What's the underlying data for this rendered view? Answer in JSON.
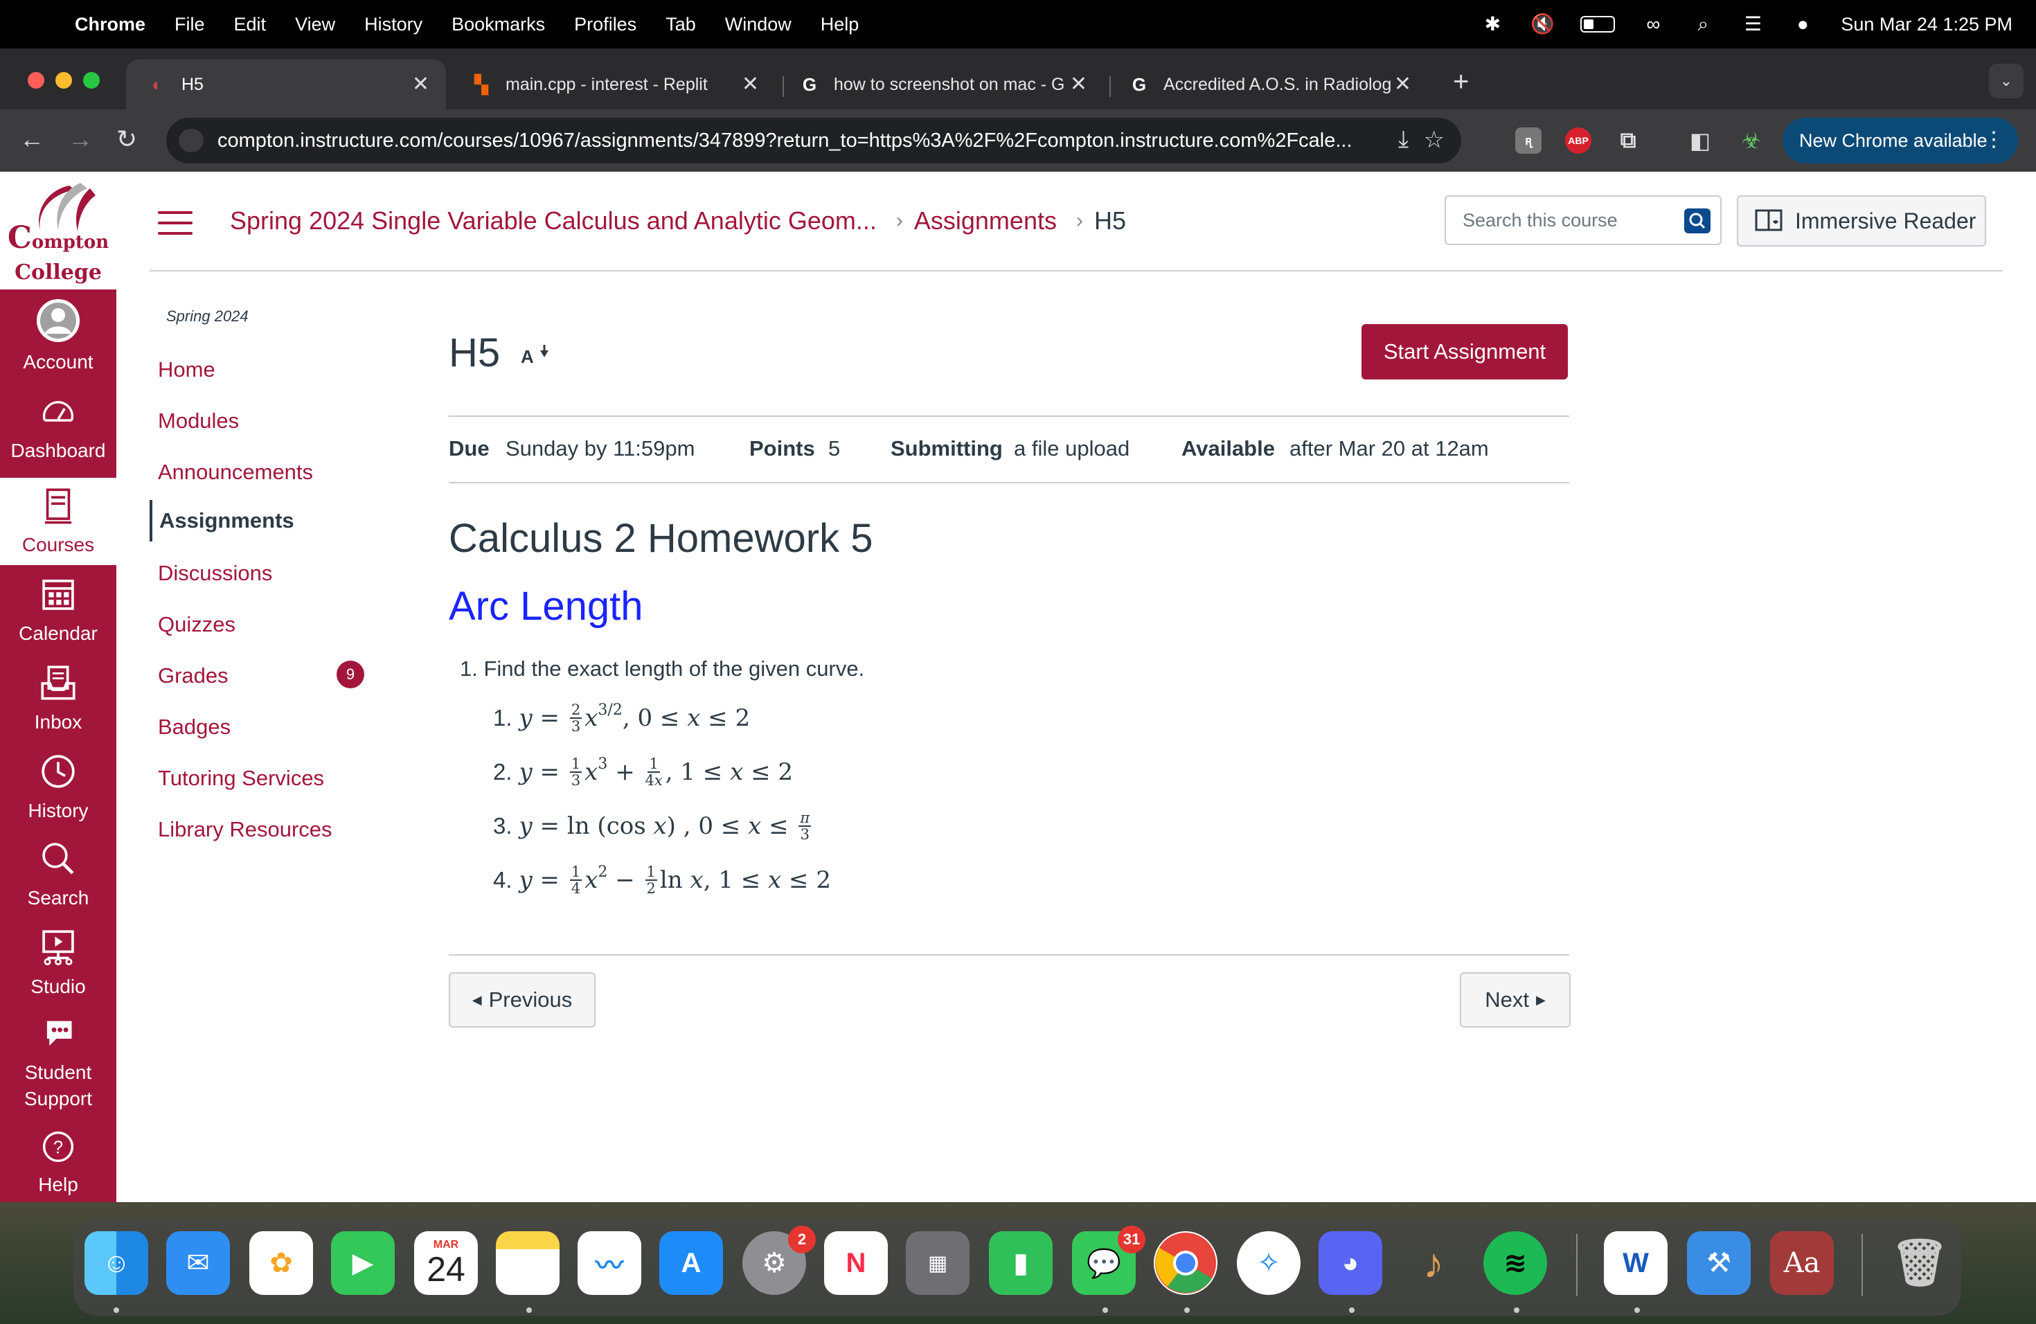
{
  "menubar": {
    "app": "Chrome",
    "items": [
      "File",
      "Edit",
      "View",
      "History",
      "Bookmarks",
      "Profiles",
      "Tab",
      "Window",
      "Help"
    ],
    "datetime": "Sun Mar 24  1:25 PM"
  },
  "tabs": [
    {
      "title": "H5",
      "active": true
    },
    {
      "title": "main.cpp - interest - Replit"
    },
    {
      "title": "how to screenshot on mac - G"
    },
    {
      "title": "Accredited A.O.S. in Radiolog"
    }
  ],
  "toolbar": {
    "url": "compton.instructure.com/courses/10967/assignments/347899?return_to=https%3A%2F%2Fcompton.instructure.com%2Fcale...",
    "new_chrome": "New Chrome available",
    "abp": "ABP"
  },
  "logo": {
    "line1": "ompton",
    "line2": "College",
    "initial": "C"
  },
  "global_nav": [
    {
      "label": "Account",
      "icon": "account-icon"
    },
    {
      "label": "Dashboard",
      "icon": "dashboard-icon"
    },
    {
      "label": "Courses",
      "icon": "courses-icon",
      "active": true
    },
    {
      "label": "Calendar",
      "icon": "calendar-icon"
    },
    {
      "label": "Inbox",
      "icon": "inbox-icon"
    },
    {
      "label": "History",
      "icon": "history-icon"
    },
    {
      "label": "Search",
      "icon": "search-icon"
    },
    {
      "label": "Studio",
      "icon": "studio-icon"
    },
    {
      "label": "Student Support",
      "icon": "student-support-icon",
      "line1": "Student",
      "line2": "Support"
    },
    {
      "label": "Help",
      "icon": "help-icon"
    }
  ],
  "breadcrumb": {
    "course": "Spring 2024 Single Variable Calculus and Analytic Geom...",
    "section": "Assignments",
    "current": "H5"
  },
  "search": {
    "placeholder": "Search this course"
  },
  "immersive_reader": "Immersive Reader",
  "course_nav": {
    "term": "Spring 2024",
    "items": [
      "Home",
      "Modules",
      "Announcements",
      "Assignments",
      "Discussions",
      "Quizzes",
      "Grades",
      "Badges",
      "Tutoring Services",
      "Library Resources"
    ],
    "active": "Assignments",
    "grades_badge": "9"
  },
  "assignment": {
    "title": "H5",
    "start_button": "Start Assignment",
    "due_label": "Due",
    "due_value": "Sunday by 11:59pm",
    "points_label": "Points",
    "points_value": "5",
    "submitting_label": "Submitting",
    "submitting_value": "a file upload",
    "available_label": "Available",
    "available_value": "after Mar 20 at 12am",
    "heading": "Calculus 2 Homework 5",
    "subheading": "Arc Length",
    "question": "1. Find the exact length of the given curve."
  },
  "pager": {
    "previous": "Previous",
    "next": "Next"
  },
  "dock": {
    "calendar_month": "MAR",
    "calendar_day": "24",
    "settings_badge": "2",
    "messages_badge": "31",
    "word_letter": "W",
    "dictionary_label": "Aa",
    "apps": [
      "Finder",
      "Mail",
      "Photos",
      "FaceTime",
      "Calendar",
      "Notes",
      "Freeform",
      "App Store",
      "System Settings",
      "News",
      "Launchpad",
      "Numbers",
      "Messages",
      "Chrome",
      "Safari",
      "Discord",
      "GarageBand",
      "Spotify",
      "Word",
      "Xcode",
      "Dictionary",
      "Trash"
    ]
  }
}
